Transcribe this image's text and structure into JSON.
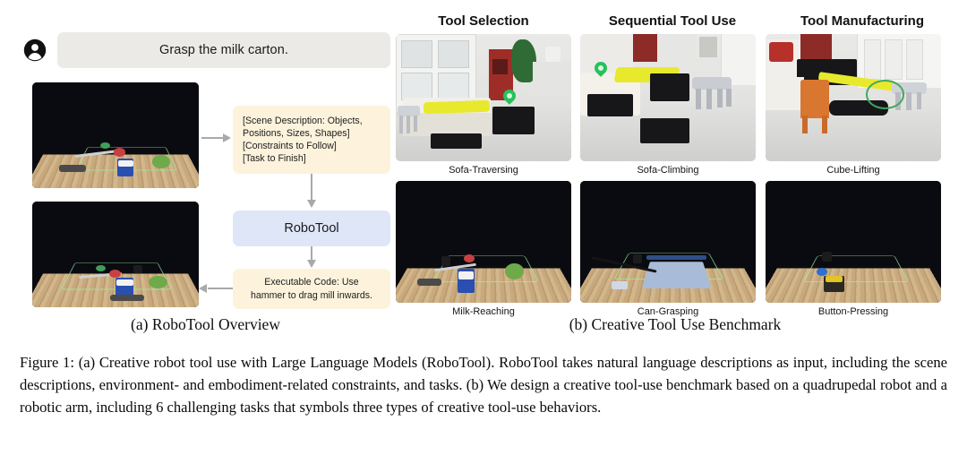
{
  "figure": {
    "caption_label": "Figure 1:",
    "caption_text": "  (a) Creative robot tool use with Large Language Models (RoboTool).  RoboTool takes natural language descriptions as input, including the scene descriptions, environment- and embodiment-related constraints, and tasks.  (b) We design a creative tool-use benchmark based on a quadrupedal robot and a robotic arm, including 6 challenging tasks that symbols three types of creative tool-use behaviors."
  },
  "panel_a": {
    "sub_caption": "(a) RoboTool Overview",
    "avatar_icon": "user-avatar-icon",
    "prompt": "Grasp the milk carton.",
    "input_box": {
      "line1": "[Scene Description: Objects,",
      "line2": "Positions, Sizes, Shapes]",
      "line3": "[Constraints to Follow]",
      "line4": "[Task to Finish]"
    },
    "model_box": "RoboTool",
    "output_box": {
      "line1": "Executable Code: Use",
      "line2": "hammer to drag mill inwards."
    },
    "photos": [
      {
        "name": "robot-arm-initial-scene"
      },
      {
        "name": "robot-arm-execution-scene"
      }
    ],
    "colors": {
      "input_box_bg": "#fdf3dd",
      "model_box_bg": "#dfe6f7",
      "output_box_bg": "#fdf3dd",
      "bubble_bg": "#eceae7",
      "arrow": "#a9a9a9"
    }
  },
  "panel_b": {
    "sub_caption": "(b) Creative Tool Use Benchmark",
    "column_headers": [
      "Tool Selection",
      "Sequential Tool Use",
      "Tool Manufacturing"
    ],
    "rows": [
      {
        "robot": "quadrupedal",
        "cells": [
          {
            "label": "Sofa-Traversing"
          },
          {
            "label": "Sofa-Climbing"
          },
          {
            "label": "Cube-Lifting"
          }
        ]
      },
      {
        "robot": "robotic-arm",
        "cells": [
          {
            "label": "Milk-Reaching"
          },
          {
            "label": "Can-Grasping"
          },
          {
            "label": "Button-Pressing"
          }
        ]
      }
    ],
    "colors": {
      "goal_pin": "#27c15a",
      "highlight_circle": "#3fa85f",
      "tool_board": "#e8e92c"
    }
  }
}
